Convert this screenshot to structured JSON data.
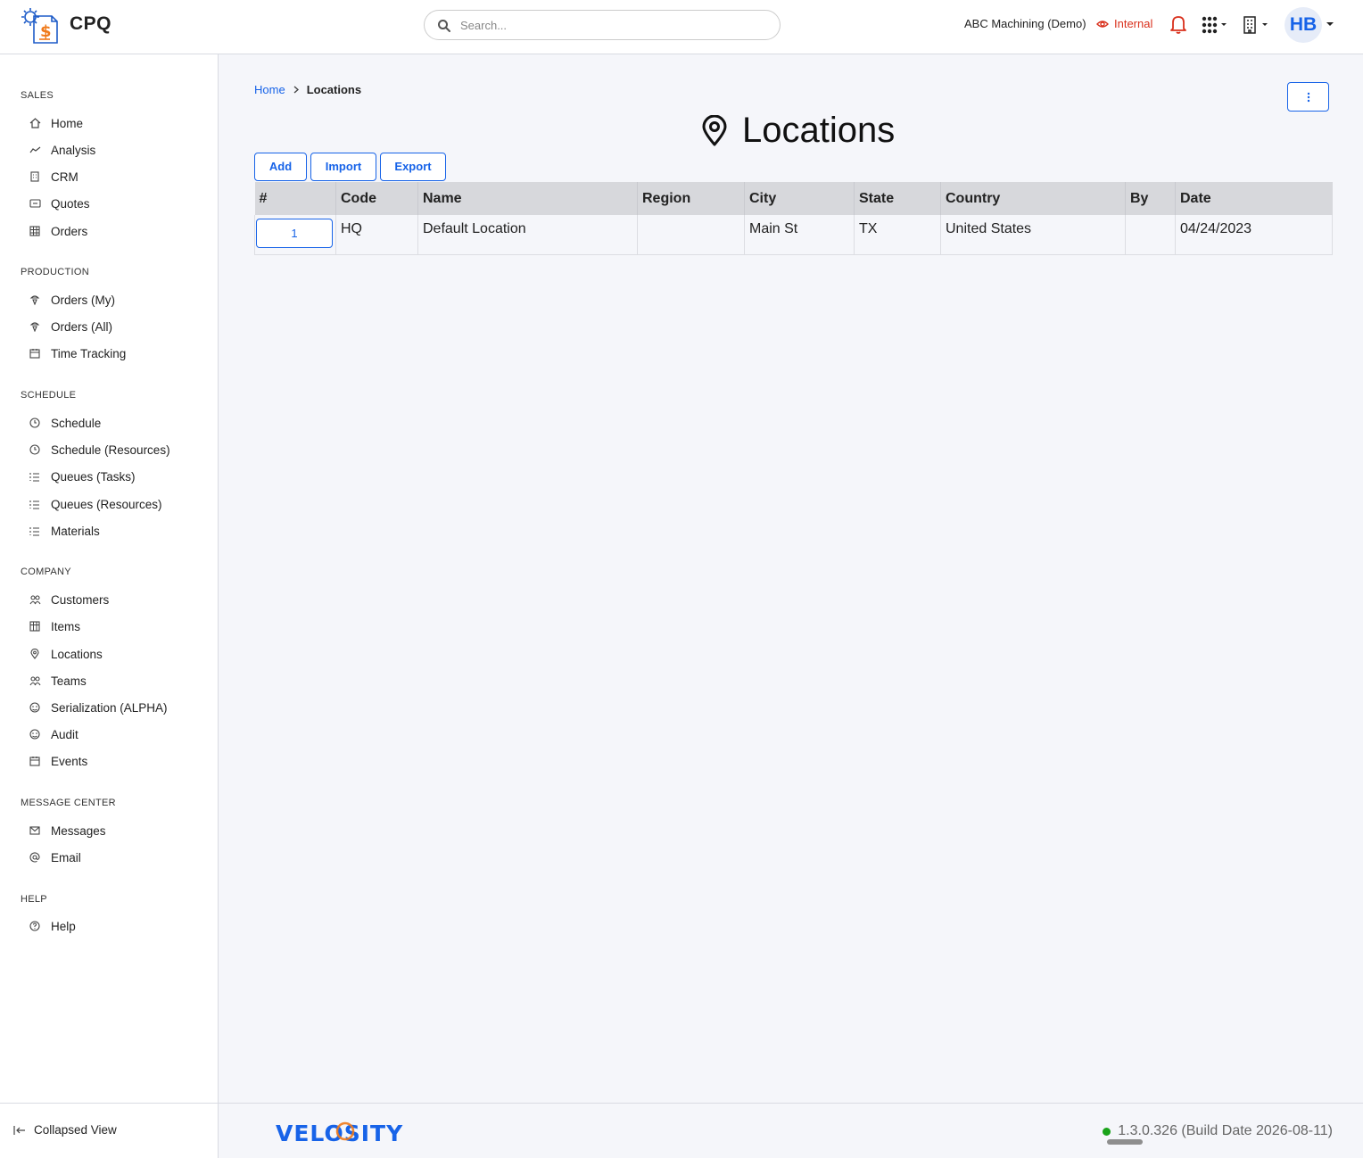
{
  "header": {
    "app_title": "CPQ",
    "search_placeholder": "Search...",
    "company_name": "ABC Machining (Demo)",
    "mode_label": "Internal",
    "avatar_initials": "HB",
    "accent_color": "#1763e8",
    "mode_color": "#d9301c"
  },
  "sidebar": {
    "sections": [
      {
        "title": "SALES",
        "items": [
          {
            "label": "Home",
            "icon": "home-icon"
          },
          {
            "label": "Analysis",
            "icon": "trend-icon"
          },
          {
            "label": "CRM",
            "icon": "building-icon"
          },
          {
            "label": "Quotes",
            "icon": "quote-icon"
          },
          {
            "label": "Orders",
            "icon": "table-icon"
          }
        ]
      },
      {
        "title": "PRODUCTION",
        "items": [
          {
            "label": "Orders (My)",
            "icon": "worker-icon"
          },
          {
            "label": "Orders (All)",
            "icon": "worker-icon"
          },
          {
            "label": "Time Tracking",
            "icon": "calendar-icon"
          }
        ]
      },
      {
        "title": "SCHEDULE",
        "items": [
          {
            "label": "Schedule",
            "icon": "clock-icon"
          },
          {
            "label": "Schedule (Resources)",
            "icon": "clock-icon"
          },
          {
            "label": "Queues (Tasks)",
            "icon": "list-icon"
          },
          {
            "label": "Queues (Resources)",
            "icon": "list-icon"
          },
          {
            "label": "Materials",
            "icon": "list-icon"
          }
        ]
      },
      {
        "title": "COMPANY",
        "items": [
          {
            "label": "Customers",
            "icon": "customers-icon"
          },
          {
            "label": "Items",
            "icon": "items-icon"
          },
          {
            "label": "Locations",
            "icon": "location-pin-icon"
          },
          {
            "label": "Teams",
            "icon": "team-icon"
          },
          {
            "label": "Serialization (ALPHA)",
            "icon": "face-icon"
          },
          {
            "label": "Audit",
            "icon": "face-icon"
          },
          {
            "label": "Events",
            "icon": "calendar-icon"
          }
        ]
      },
      {
        "title": "MESSAGE CENTER",
        "items": [
          {
            "label": "Messages",
            "icon": "envelope-icon"
          },
          {
            "label": "Email",
            "icon": "at-icon"
          }
        ]
      },
      {
        "title": "HELP",
        "items": [
          {
            "label": "Help",
            "icon": "help-icon"
          }
        ]
      }
    ],
    "collapsed_view_label": "Collapsed View"
  },
  "main": {
    "breadcrumb": {
      "home": "Home",
      "current": "Locations"
    },
    "page_title": "Locations",
    "actions": {
      "add": "Add",
      "import": "Import",
      "export": "Export"
    },
    "table": {
      "columns": [
        "#",
        "Code",
        "Name",
        "Region",
        "City",
        "State",
        "Country",
        "By",
        "Date"
      ],
      "rows": [
        {
          "num": "1",
          "code": "HQ",
          "name": "Default Location",
          "region": "",
          "city": "Main St",
          "state": "TX",
          "country": "United States",
          "by": "",
          "date": "04/24/2023"
        }
      ]
    }
  },
  "footer": {
    "brand": "VELOSITY",
    "version": "1.3.0.326 (Build Date 2026-08-11)",
    "status_color": "#1aa31a"
  }
}
